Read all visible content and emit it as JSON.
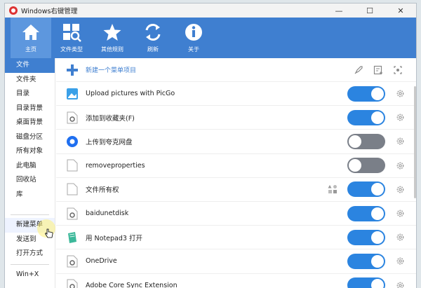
{
  "window": {
    "title": "Windows右键管理",
    "controls": [
      "—",
      "☐",
      "✕"
    ]
  },
  "colors": {
    "accent": "#3f7fd0",
    "toggle_on": "#2b84e0",
    "toggle_off": "#7a7f88"
  },
  "toolbar": {
    "home": "主页",
    "filetypes": "文件类型",
    "rules": "其他规则",
    "refresh": "刷新",
    "about": "关于"
  },
  "sidebar": {
    "group1": [
      "文件",
      "文件夹",
      "目录",
      "目录背景",
      "桌面背景",
      "磁盘分区",
      "所有对象",
      "此电脑",
      "回收站",
      "库"
    ],
    "group2": [
      "新建菜单",
      "发送到",
      "打开方式"
    ],
    "group3": [
      "Win+X"
    ]
  },
  "main": {
    "new_item": "新建一个菜单项目",
    "rows": [
      {
        "label": "Upload pictures with PicGo",
        "icon": "picgo-icon",
        "state": "on"
      },
      {
        "label": "添加到收藏夹(F)",
        "icon": "gear-doc-icon",
        "state": "on"
      },
      {
        "label": "上传到夸克网盘",
        "icon": "quark-icon",
        "state": "off"
      },
      {
        "label": "removeproperties",
        "icon": "doc-icon",
        "state": "off"
      },
      {
        "label": "文件所有权",
        "icon": "doc-icon",
        "state": "on"
      },
      {
        "label": "baidunetdisk",
        "icon": "gear-doc-icon",
        "state": "on"
      },
      {
        "label": "用 Notepad3 打开",
        "icon": "notepad3-icon",
        "state": "on"
      },
      {
        "label": "OneDrive",
        "icon": "gear-doc-icon",
        "state": "on"
      },
      {
        "label": "Adobe Core Sync Extension",
        "icon": "gear-doc-icon",
        "state": "on"
      }
    ]
  }
}
